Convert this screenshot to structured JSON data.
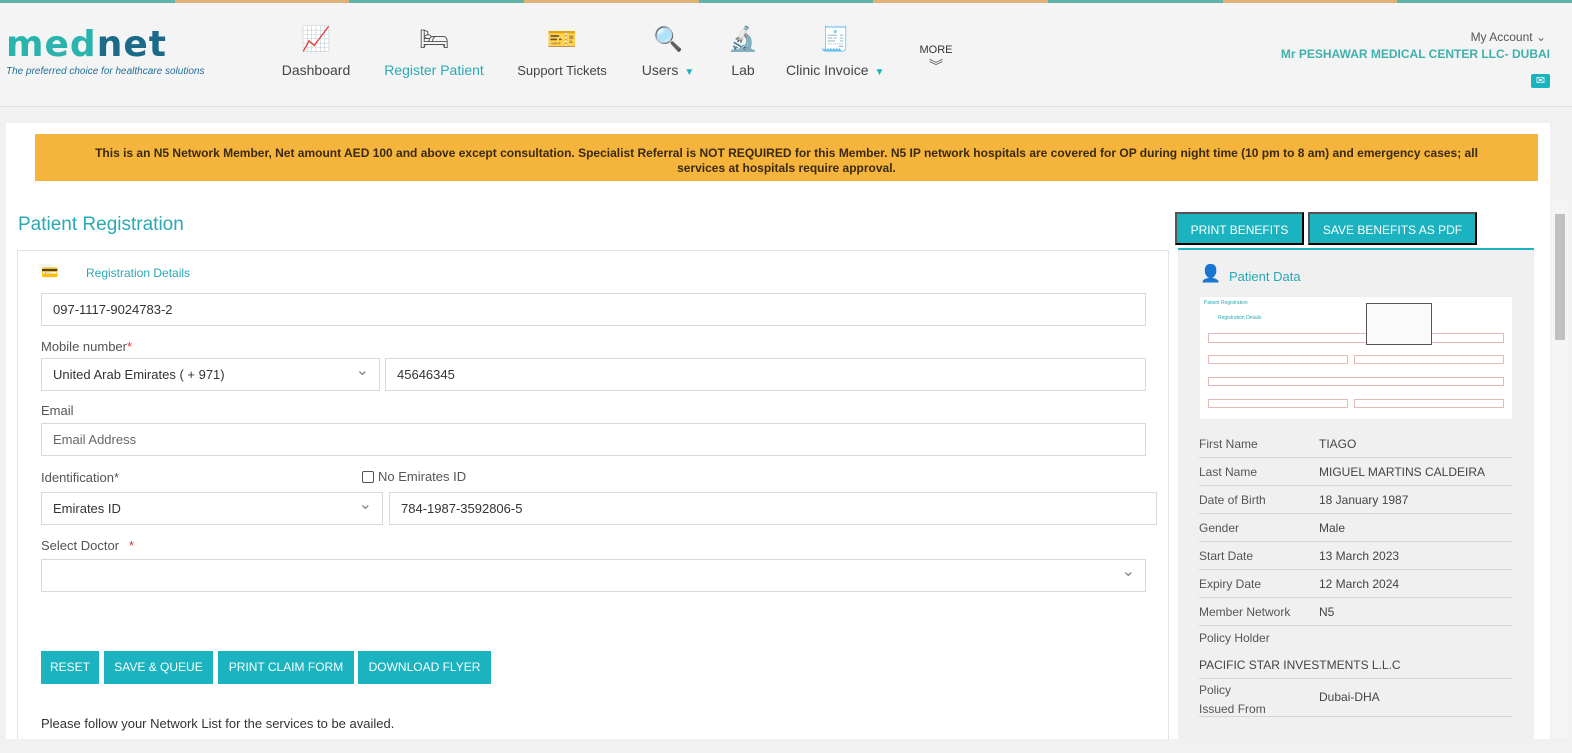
{
  "header": {
    "logo_left": "med",
    "logo_right": "net",
    "tagline": "The preferred choice for healthcare solutions",
    "nav": [
      {
        "label": "Dashboard",
        "icon": "chart-board-icon"
      },
      {
        "label": "Register Patient",
        "icon": "patient-bed-icon",
        "active": true
      },
      {
        "label": "Support Tickets",
        "icon": "ticket-icon"
      },
      {
        "label": "Users",
        "icon": "user-search-icon",
        "dropdown": true
      },
      {
        "label": "Lab",
        "icon": "microscope-icon"
      },
      {
        "label": "Clinic Invoice",
        "icon": "invoice-icon",
        "dropdown": true
      }
    ],
    "more": "MORE",
    "account": "My Account",
    "center": "Mr PESHAWAR MEDICAL CENTER LLC- DUBAI"
  },
  "colors": {
    "accent": "#1ab3bf",
    "banner": "#f5b43c",
    "stripe_teal": "#5fb3a8",
    "stripe_orange": "#e0b277"
  },
  "banner": "This is an N5 Network Member, Net amount AED 100 and above except consultation. Specialist Referral is NOT REQUIRED for this Member. N5 IP network hospitals are covered for OP during night time (10 pm to 8 am) and emergency cases; all services at hospitals require approval.",
  "form": {
    "title": "Patient Registration",
    "section": "Registration Details",
    "card_number": "097-1117-9024783-2",
    "mobile_label": "Mobile number",
    "country": "United Arab Emirates ( + 971)",
    "phone": "45646345",
    "email_label": "Email",
    "email_placeholder": "Email Address",
    "id_label": "Identification*",
    "no_eid": "No Emirates ID",
    "id_type": "Emirates ID",
    "id_number": "784-1987-3592806-5",
    "doctor_label": "Select Doctor",
    "req": "*",
    "buttons": [
      "RESET",
      "SAVE & QUEUE",
      "PRINT CLAIM FORM",
      "DOWNLOAD FLYER"
    ],
    "note": "Please follow your Network List for the services to be availed."
  },
  "benefits": {
    "print": "PRINT BENEFITS",
    "save_pdf": "SAVE BENEFITS AS PDF",
    "title": "Patient Data",
    "thumbnail": {
      "title": "Patient Registration",
      "section": "Registration Details"
    },
    "rows": [
      {
        "k": "First Name",
        "v": "TIAGO"
      },
      {
        "k": "Last Name",
        "v": "MIGUEL MARTINS CALDEIRA"
      },
      {
        "k": "Date of Birth",
        "v": "18 January 1987"
      },
      {
        "k": "Gender",
        "v": "Male"
      },
      {
        "k": "Start Date",
        "v": "13 March 2023"
      },
      {
        "k": "Expiry Date",
        "v": "12 March 2024"
      },
      {
        "k": "Member Network",
        "v": "N5"
      }
    ],
    "policy_holder_label": "Policy Holder",
    "policy_holder": "PACIFIC STAR INVESTMENTS L.L.C",
    "issued_label": "Policy Issued From",
    "issued": "Dubai-DHA"
  }
}
